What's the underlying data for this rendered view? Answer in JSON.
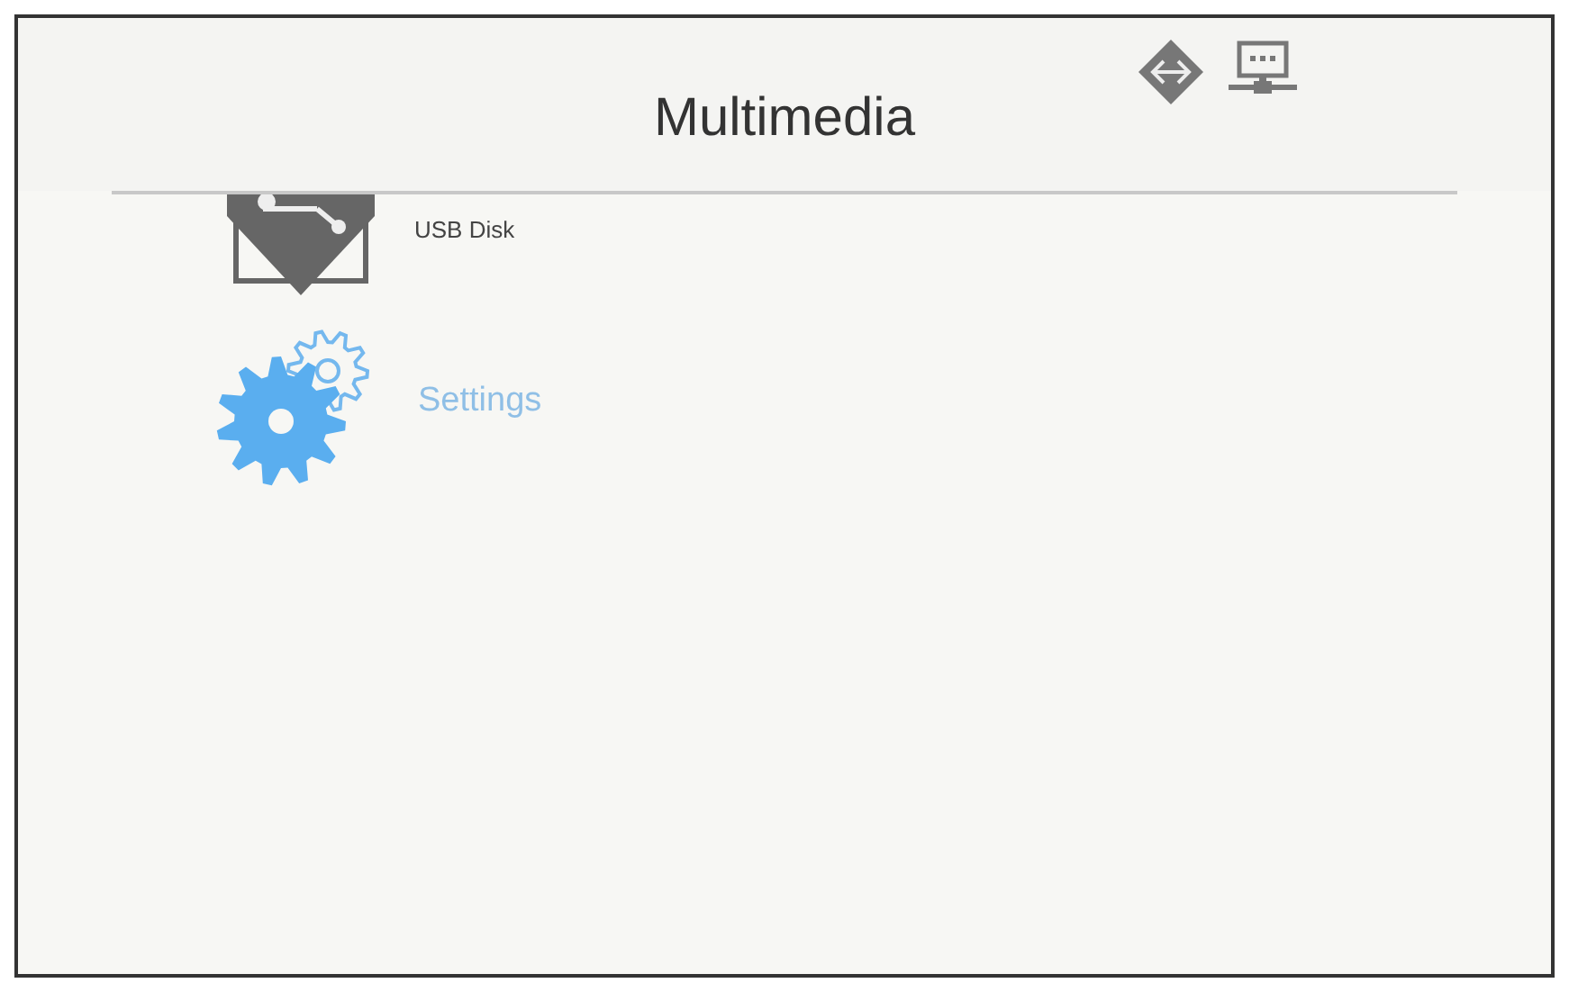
{
  "header": {
    "title": "Multimedia"
  },
  "items": [
    {
      "kind": "usb",
      "label": "USB Disk",
      "selected": false
    },
    {
      "kind": "settings",
      "label": "Settings",
      "selected": true
    }
  ]
}
